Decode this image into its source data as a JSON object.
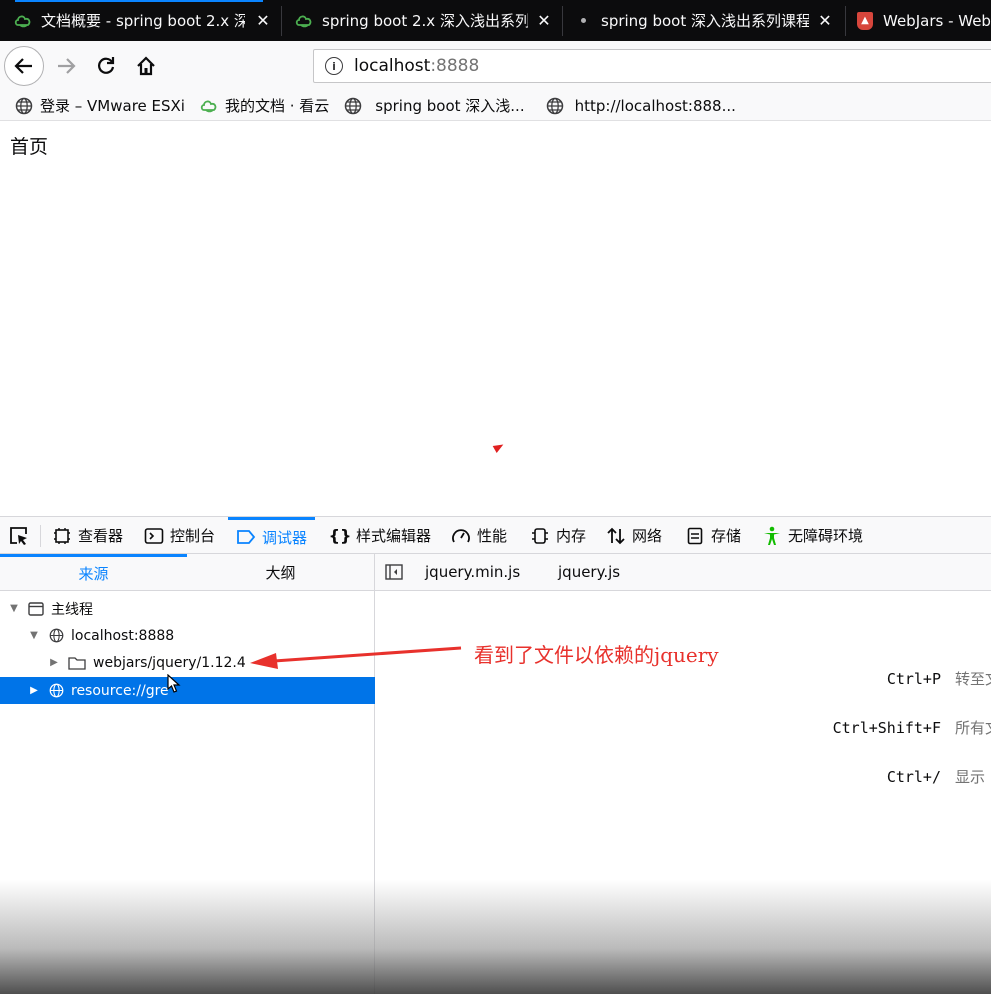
{
  "tabs": [
    {
      "title": "文档概要 - spring boot 2.x 深",
      "favicon": "kanyun-icon",
      "active": true
    },
    {
      "title": "spring boot 2.x 深入浅出系列",
      "favicon": "kanyun-icon",
      "active": false
    },
    {
      "title": "spring boot 深入浅出系列课程",
      "favicon": "dot-icon",
      "active": false
    },
    {
      "title": "WebJars - Web",
      "favicon": "webjars-icon",
      "active": false
    }
  ],
  "address_bar": {
    "host": "localhost",
    "port": ":8888"
  },
  "bookmarks": [
    {
      "label": "登录 – VMware ESXi",
      "icon": "globe-icon"
    },
    {
      "label": "我的文档 · 看云",
      "icon": "kanyun-icon"
    },
    {
      "label": "spring boot 深入浅...",
      "icon": "globe-icon"
    },
    {
      "label": "http://localhost:888...",
      "icon": "globe-icon"
    }
  ],
  "page": {
    "text": "首页"
  },
  "devtools": {
    "tabs": [
      {
        "label": "查看器",
        "icon": "inspector-icon"
      },
      {
        "label": "控制台",
        "icon": "console-icon"
      },
      {
        "label": "调试器",
        "icon": "debugger-icon",
        "selected": true
      },
      {
        "label": "样式编辑器",
        "icon": "braces-icon"
      },
      {
        "label": "性能",
        "icon": "gauge-icon"
      },
      {
        "label": "内存",
        "icon": "memory-icon"
      },
      {
        "label": "网络",
        "icon": "network-icon"
      },
      {
        "label": "存储",
        "icon": "storage-icon"
      },
      {
        "label": "无障碍环境",
        "icon": "accessibility-icon"
      }
    ],
    "left_tabs": [
      {
        "label": "来源",
        "selected": true
      },
      {
        "label": "大纲"
      }
    ],
    "tree": [
      {
        "label": "主线程",
        "expanded": true
      },
      {
        "label": "localhost:8888",
        "expanded": true
      },
      {
        "label": "webjars/jquery/1.12.4",
        "expanded": false
      },
      {
        "label": "resource://gre",
        "expanded": false,
        "selected": true
      }
    ],
    "source_tabs": [
      {
        "label": "jquery.min.js"
      },
      {
        "label": "jquery.js"
      }
    ],
    "shortcuts": [
      {
        "key": "Ctrl+P",
        "desc": "转至文"
      },
      {
        "key": "Ctrl+Shift+F",
        "desc": "所有文"
      },
      {
        "key": "Ctrl+/",
        "desc": "显示"
      }
    ]
  },
  "annotation": {
    "text": "看到了文件以依赖的jquery",
    "color": "#e8312c"
  },
  "colors": {
    "accent": "#0a84ff",
    "selection": "#0074e8",
    "tab_strip": "#0c0c0d"
  }
}
